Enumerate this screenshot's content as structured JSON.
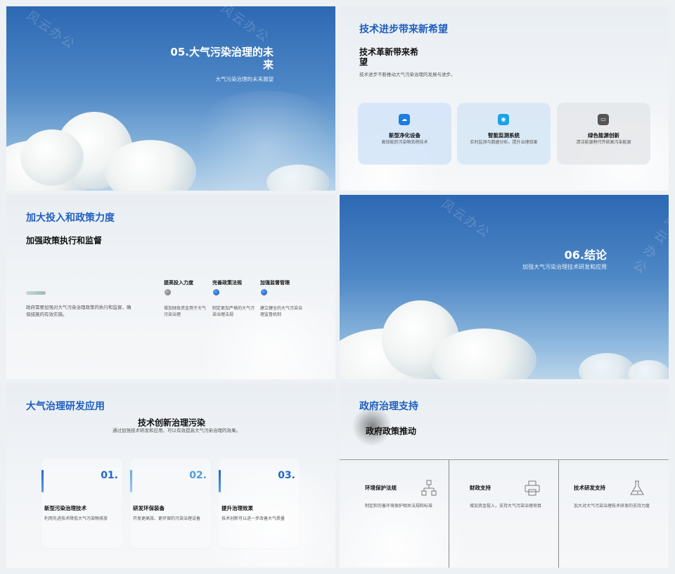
{
  "slide1": {
    "title": "05.大气污染治理的未来",
    "subtitle": "大气污染治理的未来展望"
  },
  "slide2": {
    "section": "技术进步带来新希望",
    "heading": "技术革新带来希望",
    "desc": "技术进步不断推动大气污染治理的发展与进步。",
    "cards": [
      {
        "title": "新型净化设备",
        "desc": "高效能的污染物去除技术",
        "icon": "cloud-icon",
        "color": "#1a7ee0"
      },
      {
        "title": "智能监测系统",
        "desc": "实时监测与数据分析，提升治理效果",
        "icon": "monitor-icon",
        "color": "#1ba2e8"
      },
      {
        "title": "绿色能源创新",
        "desc": "清洁能源替代传统高污染能源",
        "icon": "energy-icon",
        "color": "#555555"
      }
    ]
  },
  "slide3": {
    "section": "加大投入和政策力度",
    "heading": "加强政策执行和监督",
    "desc": "政府需要加强对大气污染治理政策的执行和监督，确保措施的有效实施。",
    "columns": [
      {
        "title": "提高投入力度",
        "desc": "增加财政资金用于大气污染治理",
        "color": "#8c8c8c"
      },
      {
        "title": "完善政策法规",
        "desc": "制定更加严格的大气污染治理法规",
        "color": "#1e6fd1"
      },
      {
        "title": "加强监督管理",
        "desc": "建立健全的大气污染治理监督机制",
        "color": "#1e6fd1"
      }
    ]
  },
  "slide4": {
    "title": "06.结论",
    "subtitle": "加强大气污染治理技术研发和应用"
  },
  "slide5": {
    "section": "大气治理研发应用",
    "heading": "技术创新治理污染",
    "desc": "通过加强技术研发和应用，可以有效提高大气污染治理的效果。",
    "cards": [
      {
        "num": "01.",
        "title": "新型污染治理技术",
        "desc": "利用先进技术降低大气污染物排放",
        "color": "#1e66cc"
      },
      {
        "num": "02.",
        "title": "研发环保装备",
        "desc": "开发更高效、更环保的污染治理设备",
        "color": "#4d9de0"
      },
      {
        "num": "03.",
        "title": "提升治理效果",
        "desc": "技术创新可以进一步改善大气质量",
        "color": "#1e66cc"
      }
    ]
  },
  "slide6": {
    "section": "政府治理支持",
    "heading": "政府政策推动",
    "items": [
      {
        "title": "环境保护法规",
        "desc": "制定和完善环境保护相关法规和标准",
        "icon": "org-chart-icon"
      },
      {
        "title": "财政支持",
        "desc": "增加资金投入，支持大气污染治理项目",
        "icon": "printer-icon"
      },
      {
        "title": "技术研发支持",
        "desc": "加大对大气污染治理技术研发的支持力度",
        "icon": "flask-icon"
      }
    ]
  },
  "watermark": "风云办公"
}
